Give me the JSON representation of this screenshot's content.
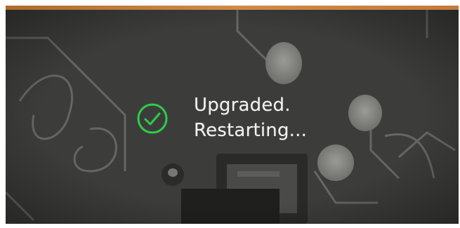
{
  "status": {
    "line1": "Upgraded.",
    "line2": "Restarting...",
    "icon": "check-circle-icon",
    "icon_color": "#2ecc4a",
    "text_color": "#f2f2f0"
  },
  "colors": {
    "board": "#3b3c3a",
    "trace": "#7b7d79",
    "copper_strip": "#c47a3b"
  }
}
